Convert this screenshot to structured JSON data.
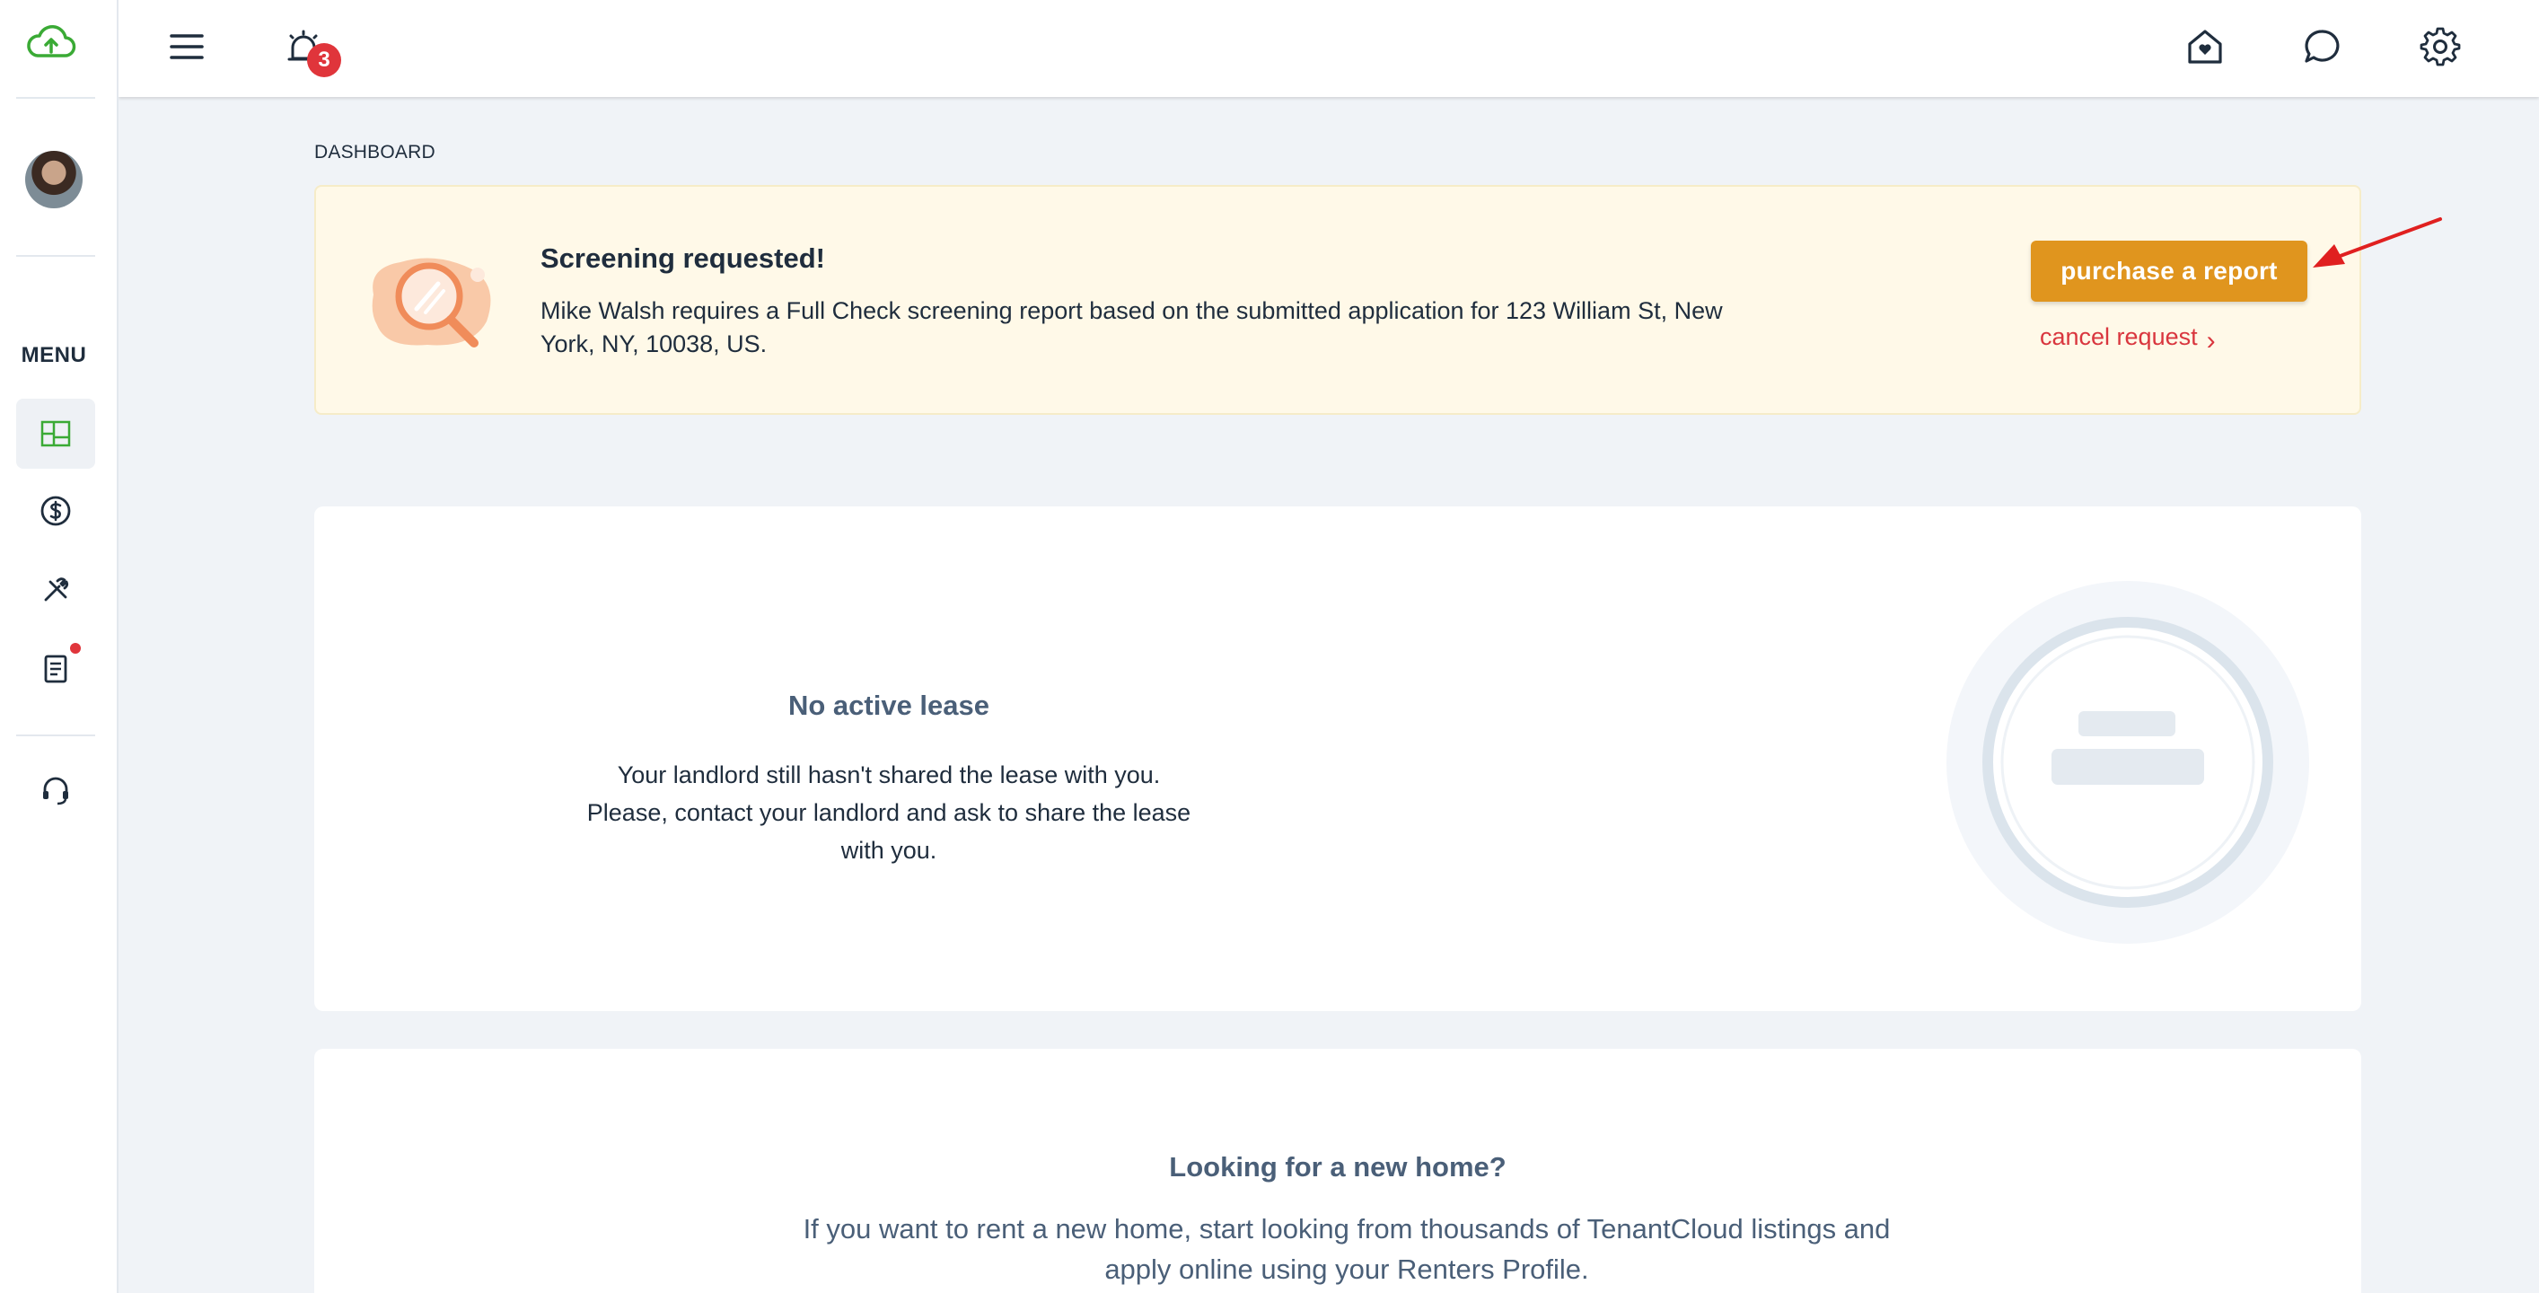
{
  "sidebar": {
    "menu_label": "MENU",
    "items": [
      {
        "name": "dashboard",
        "icon": "dashboard-icon",
        "active": true
      },
      {
        "name": "payments",
        "icon": "dollar-circle-icon"
      },
      {
        "name": "maintenance",
        "icon": "tools-icon"
      },
      {
        "name": "documents",
        "icon": "document-icon",
        "has_notification": true
      },
      {
        "name": "support",
        "icon": "headset-icon"
      }
    ]
  },
  "topbar": {
    "notifications_count": "3"
  },
  "breadcrumb": "DASHBOARD",
  "alert": {
    "title": "Screening requested!",
    "message": "Mike Walsh requires a Full Check screening report based on the submitted application for 123 William St, New York, NY, 10038, US.",
    "primary_button": "purchase a report",
    "cancel_link": "cancel request",
    "cancel_chevron": "›"
  },
  "lease_card": {
    "title": "No active lease",
    "text": "Your landlord still hasn't shared the lease with you. Please, contact your landlord and ask to share the lease with you."
  },
  "home_card": {
    "title": "Looking for a new home?",
    "text": "If you want to rent a new home, start looking from thousands of TenantCloud listings and apply online using your Renters Profile."
  },
  "colors": {
    "brand_green": "#3aaa35",
    "accent_orange": "#e0951e",
    "danger_red": "#d9363e",
    "alert_bg": "#fff9e8"
  }
}
